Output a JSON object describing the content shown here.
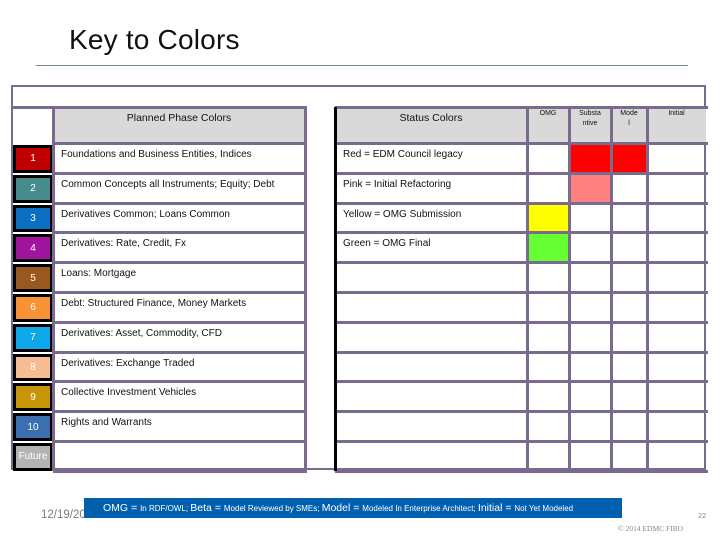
{
  "title": "Key to Colors",
  "planned_phase": {
    "header": "Planned Phase Colors",
    "rows": [
      {
        "num": "1",
        "label": "Foundations and Business Entities, Indices",
        "color": "#c00000"
      },
      {
        "num": "2",
        "label": "Common Concepts all Instruments; Equity; Debt",
        "color": "#468c8c"
      },
      {
        "num": "3",
        "label": "Derivatives Common; Loans Common",
        "color": "#0a6fc0"
      },
      {
        "num": "4",
        "label": "Derivatives: Rate, Credit, Fx",
        "color": "#a0159e"
      },
      {
        "num": "5",
        "label": "Loans: Mortgage",
        "color": "#99581f"
      },
      {
        "num": "6",
        "label": "Debt: Structured Finance, Money Markets",
        "color": "#f79235"
      },
      {
        "num": "7",
        "label": "Derivatives: Asset, Commodity, CFD",
        "color": "#0ea8ea"
      },
      {
        "num": "8",
        "label": "Derivatives: Exchange Traded",
        "color": "#f8bc92"
      },
      {
        "num": "9",
        "label": "Collective Investment Vehicles",
        "color": "#c8950a"
      },
      {
        "num": "10",
        "label": "Rights and Warrants",
        "color": "#3c6fb0"
      },
      {
        "num": "Future",
        "label": "",
        "color": "#b3b3b3"
      }
    ]
  },
  "status": {
    "header": "Status Colors",
    "columns": [
      "OMG",
      "Substa ntive",
      "Mode l",
      "Initial"
    ],
    "rows": [
      {
        "label": "Red = EDM Council legacy",
        "fills": [
          "",
          "#ff0000",
          "#ff0000",
          ""
        ]
      },
      {
        "label": "Pink = Initial Refactoring",
        "fills": [
          "",
          "#ff7f7f",
          "",
          ""
        ]
      },
      {
        "label": "Yellow = OMG Submission",
        "fills": [
          "#ffff00",
          "",
          "",
          ""
        ]
      },
      {
        "label": "Green = OMG Final",
        "fills": [
          "#66ff33",
          "",
          "",
          ""
        ]
      },
      {
        "label": "",
        "fills": [
          "",
          "",
          "",
          ""
        ]
      },
      {
        "label": "",
        "fills": [
          "",
          "",
          "",
          ""
        ]
      },
      {
        "label": "",
        "fills": [
          "",
          "",
          "",
          ""
        ]
      },
      {
        "label": "",
        "fills": [
          "",
          "",
          "",
          ""
        ]
      },
      {
        "label": "",
        "fills": [
          "",
          "",
          "",
          ""
        ]
      },
      {
        "label": "",
        "fills": [
          "",
          "",
          "",
          ""
        ]
      },
      {
        "label": "",
        "fills": [
          "",
          "",
          "",
          ""
        ]
      }
    ]
  },
  "banner": {
    "parts": [
      {
        "text": "OMG = ",
        "size": "big"
      },
      {
        "text": "In RDF/OWL; ",
        "size": "small"
      },
      {
        "text": "Beta = ",
        "size": "big"
      },
      {
        "text": "Model Reviewed by SMEs; ",
        "size": "small"
      },
      {
        "text": "Model = ",
        "size": "big"
      },
      {
        "text": "Modeled In Enterprise Architect; ",
        "size": "small"
      },
      {
        "text": "Initial = ",
        "size": "big"
      },
      {
        "text": "Not Yet Modeled",
        "size": "small"
      }
    ],
    "color": "#0060b0"
  },
  "footer": {
    "date": "12/19/2021",
    "page_number": "22",
    "copyright": "© 2014 EDMC   FIBO"
  },
  "colors": {
    "grid": "#7a6a8e",
    "header_bg": "#d9d9d9"
  }
}
